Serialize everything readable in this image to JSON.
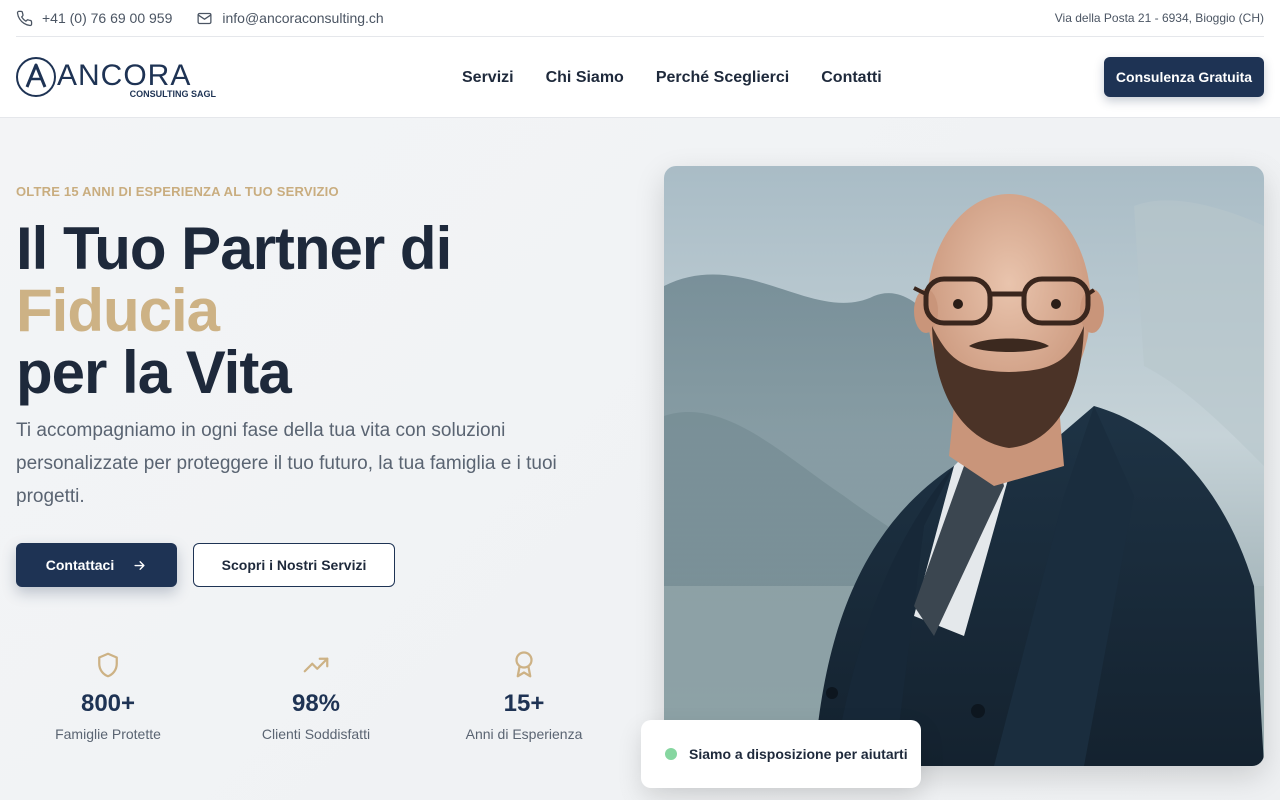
{
  "topbar": {
    "phone": "+41 (0) 76 69 00 959",
    "email": "info@ancoraconsulting.ch",
    "address": "Via della Posta 21 - 6934, Bioggio (CH)"
  },
  "header": {
    "logo": {
      "name": "ANCORA",
      "tagline": "CONSULTING SAGL"
    },
    "nav": [
      "Servizi",
      "Chi Siamo",
      "Perché Sceglierci",
      "Contatti"
    ],
    "cta_label": "Consulenza Gratuita"
  },
  "hero": {
    "eyebrow": "OLTRE 15 ANNI DI ESPERIENZA AL TUO SERVIZIO",
    "title_line1": "Il Tuo Partner di",
    "title_accent": "Fiducia",
    "title_line3": "per la Vita",
    "lead": "Ti accompagniamo in ogni fase della tua vita con soluzioni personalizzate per proteggere il tuo futuro, la tua famiglia e i tuoi progetti.",
    "primary_button": "Contattaci",
    "secondary_button": "Scopri i Nostri Servizi",
    "stats": [
      {
        "value": "800+",
        "label": "Famiglie Protette",
        "icon": "shield-icon"
      },
      {
        "value": "98%",
        "label": "Clienti Soddisfatti",
        "icon": "trending-up-icon"
      },
      {
        "value": "15+",
        "label": "Anni di Esperienza",
        "icon": "award-icon"
      }
    ],
    "availability": "Siamo a disposizione per aiutarti"
  },
  "colors": {
    "primary": "#1e3354",
    "accent": "#cdb285",
    "status": "#86d6a0"
  }
}
